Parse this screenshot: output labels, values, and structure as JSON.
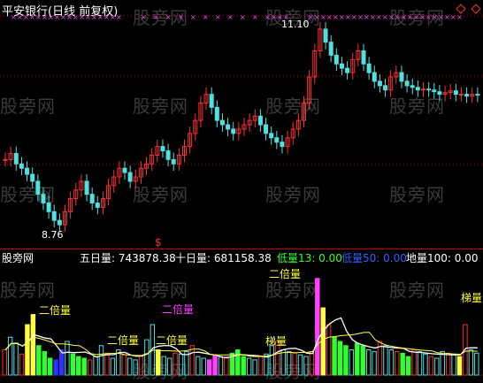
{
  "header": {
    "title": "平安银行(日线 前复权)"
  },
  "price_chart": {
    "high_label": "11.10",
    "low_label": "8.76",
    "dollar_marker": "$"
  },
  "volume_panel": {
    "watermark_label": "股旁网",
    "five_day_label": "五日量: 743878.38",
    "ten_day_label": "十日量: 681158.38",
    "low13_label": "低量13: 0.00",
    "low50_label": "低量50: 0.00",
    "ground100_label": "地量100: 0.00",
    "annotations": {
      "double1": "二倍量",
      "double2": "二倍量",
      "double3": "二倍量",
      "double4": "二倍量",
      "double5": "二倍量",
      "ladder": "梯量",
      "ladder2": "梯量"
    }
  },
  "watermarks": [
    "股旁网",
    "股旁网",
    "股旁网",
    "股旁网",
    "股旁网",
    "股旁网",
    "股旁网",
    "股旁网",
    "股旁网",
    "股旁网",
    "股旁网",
    "股旁网",
    "股旁网",
    "股旁网",
    "股旁网",
    "股旁网",
    "股旁网"
  ],
  "colors": {
    "up": "#ff3030",
    "down": "#50e0e0",
    "yellow": "#ffff40",
    "magenta": "#ff40ff",
    "green": "#30ff30",
    "blue": "#3030ff",
    "white": "#ffffff",
    "grid": "#c00000"
  }
}
